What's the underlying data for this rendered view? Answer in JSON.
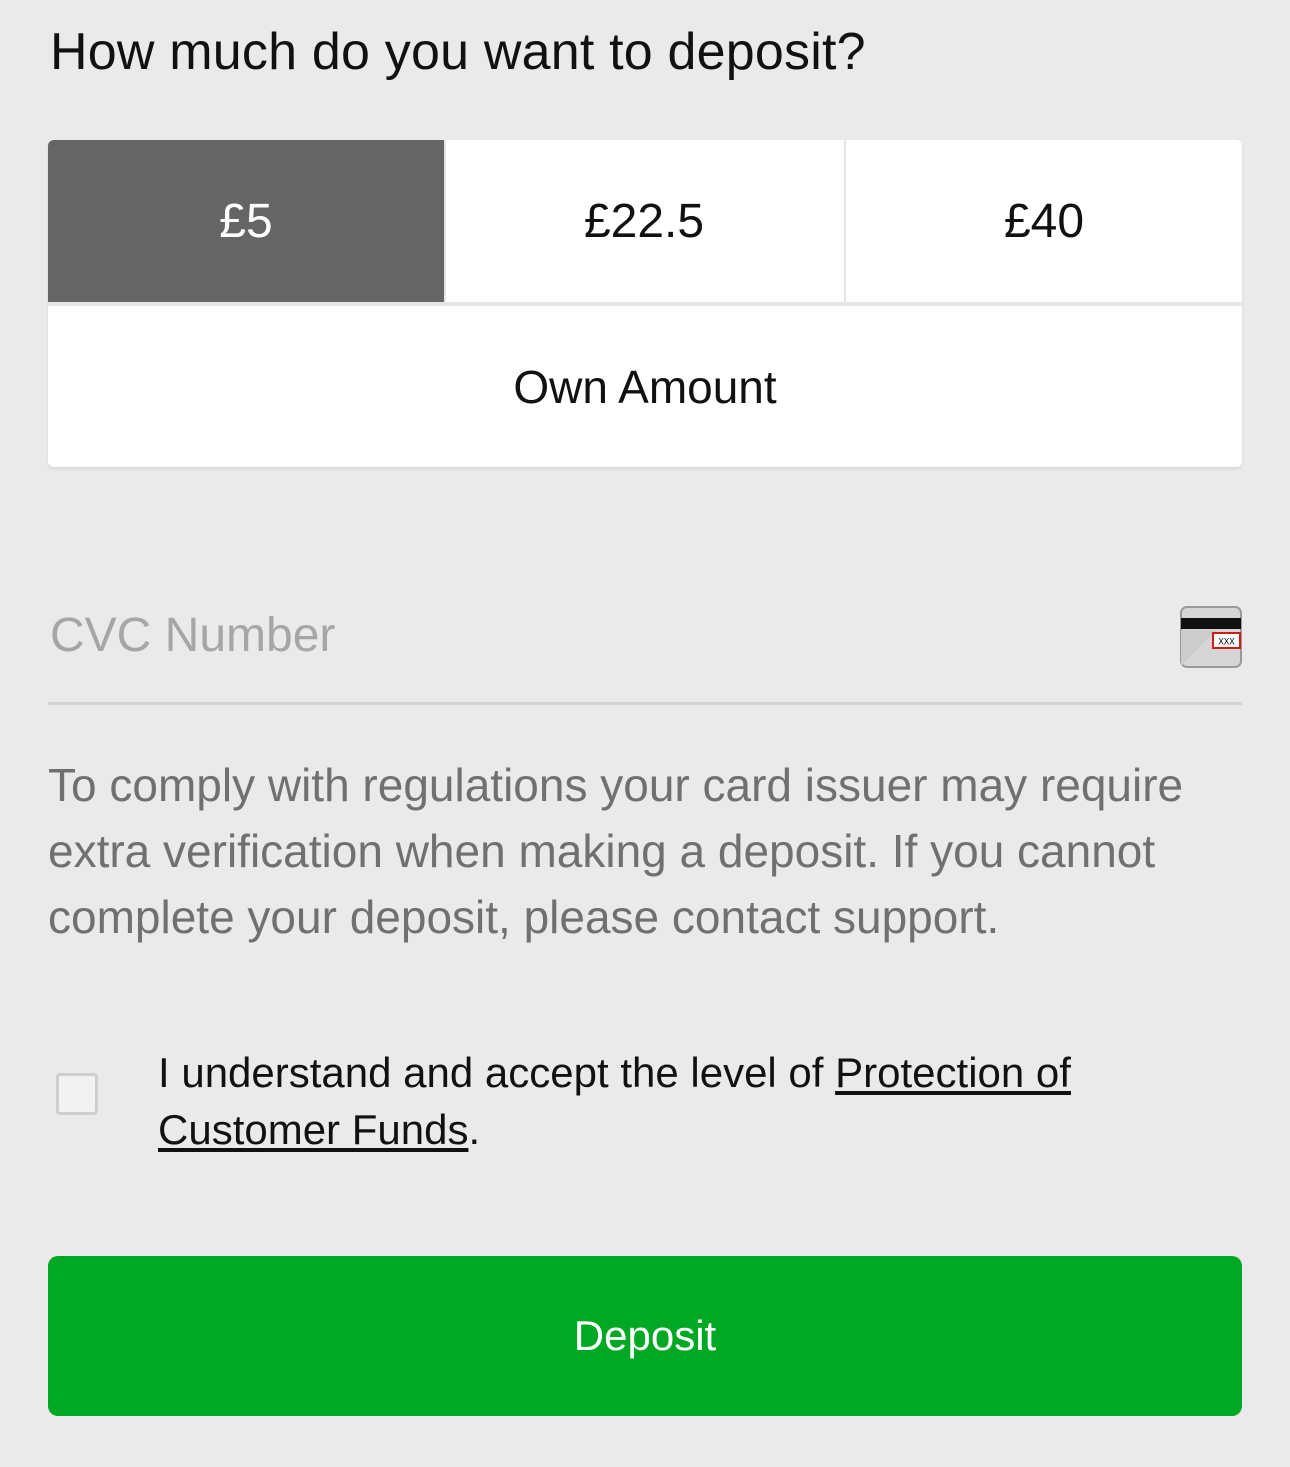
{
  "deposit_prompt": "How much do you want to deposit?",
  "amount_options": [
    {
      "label": "£5",
      "selected": true
    },
    {
      "label": "£22.5",
      "selected": false
    },
    {
      "label": "£40",
      "selected": false
    }
  ],
  "own_amount_label": "Own Amount",
  "cvc": {
    "placeholder": "CVC Number",
    "icon": "card-cvc-icon",
    "icon_text": "XXX"
  },
  "notice_text": "To comply with regulations your card issuer may require extra verification when making a deposit. If you cannot complete your deposit, please contact support.",
  "consent": {
    "checked": false,
    "text_before": "I understand and accept the level of ",
    "link_text": "Protection of Customer Funds",
    "text_after": "."
  },
  "deposit_button_label": "Deposit",
  "colors": {
    "background": "#eaeaea",
    "selected_amount": "#656565",
    "deposit_button": "#00a823",
    "notice_text": "#707070",
    "placeholder": "#a6a6a6"
  }
}
